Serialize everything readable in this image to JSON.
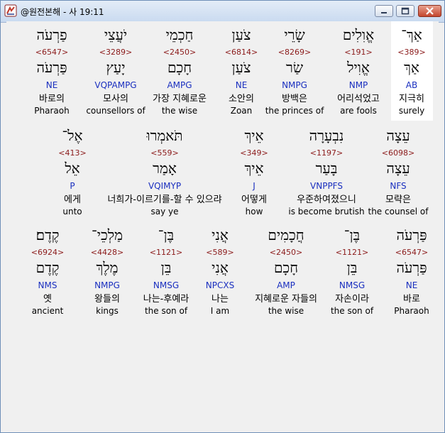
{
  "window": {
    "title": "@원전본해 - 사 19:11",
    "buttons": {
      "minimize": "minimize",
      "maximize": "maximize",
      "close": "close"
    }
  },
  "verses": [
    [
      {
        "heb": "אַךְ־",
        "num": "<389>",
        "heb2": "אַךְ",
        "parse": "AB",
        "kor": "지극히",
        "eng": "surely",
        "highlight": true
      },
      {
        "heb": "אֱוִלִים",
        "num": "<191>",
        "heb2": "אֱוִיל",
        "parse": "NMP",
        "kor": "어리석었고",
        "eng": "are fools"
      },
      {
        "heb": "שָׂרֵי",
        "num": "<8269>",
        "heb2": "שַׂר",
        "parse": "NMPG",
        "kor": "방백은",
        "eng": "the princes of"
      },
      {
        "heb": "צֹעַן",
        "num": "<6814>",
        "heb2": "צֹעַן",
        "parse": "NE",
        "kor": "소안의",
        "eng": "Zoan"
      },
      {
        "heb": "חַכְמֵי",
        "num": "<2450>",
        "heb2": "חָכָם",
        "parse": "AMPG",
        "kor": "가장 지혜로운",
        "eng": "the wise"
      },
      {
        "heb": "יֹעֲצֵי",
        "num": "<3289>",
        "heb2": "יָעַץ",
        "parse": "VQPAMPG",
        "kor": "모사의",
        "eng": "counsellors of"
      },
      {
        "heb": "פַרְעֹה",
        "num": "<6547>",
        "heb2": "פַּרְעֹה",
        "parse": "NE",
        "kor": "바로의",
        "eng": "Pharaoh"
      }
    ],
    [
      {
        "heb": "עֵצָה",
        "num": "<6098>",
        "heb2": "עֵצָה",
        "parse": "NFS",
        "kor": "모략은",
        "eng": "the counsel of"
      },
      {
        "heb": "נִבְעָרָה",
        "num": "<1197>",
        "heb2": "בָּעַר",
        "parse": "VNPPFS",
        "kor": "우준하여졌으니",
        "eng": "is become brutish"
      },
      {
        "heb": "אֵיךְ",
        "num": "<349>",
        "heb2": "אֵיךְ",
        "parse": "J",
        "kor": "어떻게",
        "eng": "how"
      },
      {
        "heb": "תֹּאמְרוּ",
        "num": "<559>",
        "heb2": "אָמַר",
        "parse": "VQIMYP",
        "kor": "너희가-이르기를-할 수 있으랴",
        "eng": "say ye"
      },
      {
        "heb": "אֶל־",
        "num": "<413>",
        "heb2": "אֵל",
        "parse": "P",
        "kor": "에게",
        "eng": "unto"
      }
    ],
    [
      {
        "heb": "פַּרְעֹה",
        "num": "<6547>",
        "heb2": "פַּרְעֹה",
        "parse": "NE",
        "kor": "바로",
        "eng": "Pharaoh"
      },
      {
        "heb": "בֶּן־",
        "num": "<1121>",
        "heb2": "בֵּן",
        "parse": "NMSG",
        "kor": "자손이라",
        "eng": "the son of"
      },
      {
        "heb": "חֲכָמִים",
        "num": "<2450>",
        "heb2": "חָכָם",
        "parse": "AMP",
        "kor": "지혜로운 자들의",
        "eng": "the wise"
      },
      {
        "heb": "אֲנִי",
        "num": "<589>",
        "heb2": "אֲנִי",
        "parse": "NPCXS",
        "kor": "나는",
        "eng": "I am"
      },
      {
        "heb": "בֶּן־",
        "num": "<1121>",
        "heb2": "בֵּן",
        "parse": "NMSG",
        "kor": "나는-후예라",
        "eng": "the son of"
      },
      {
        "heb": "מַלְכֵי־",
        "num": "<4428>",
        "heb2": "מֶלֶךְ",
        "parse": "NMPG",
        "kor": "왕들의",
        "eng": "kings"
      },
      {
        "heb": "קֶדֶם׃",
        "num": "<6924>",
        "heb2": "קֶדֶם",
        "parse": "NMS",
        "kor": "옛",
        "eng": "ancient"
      }
    ]
  ]
}
